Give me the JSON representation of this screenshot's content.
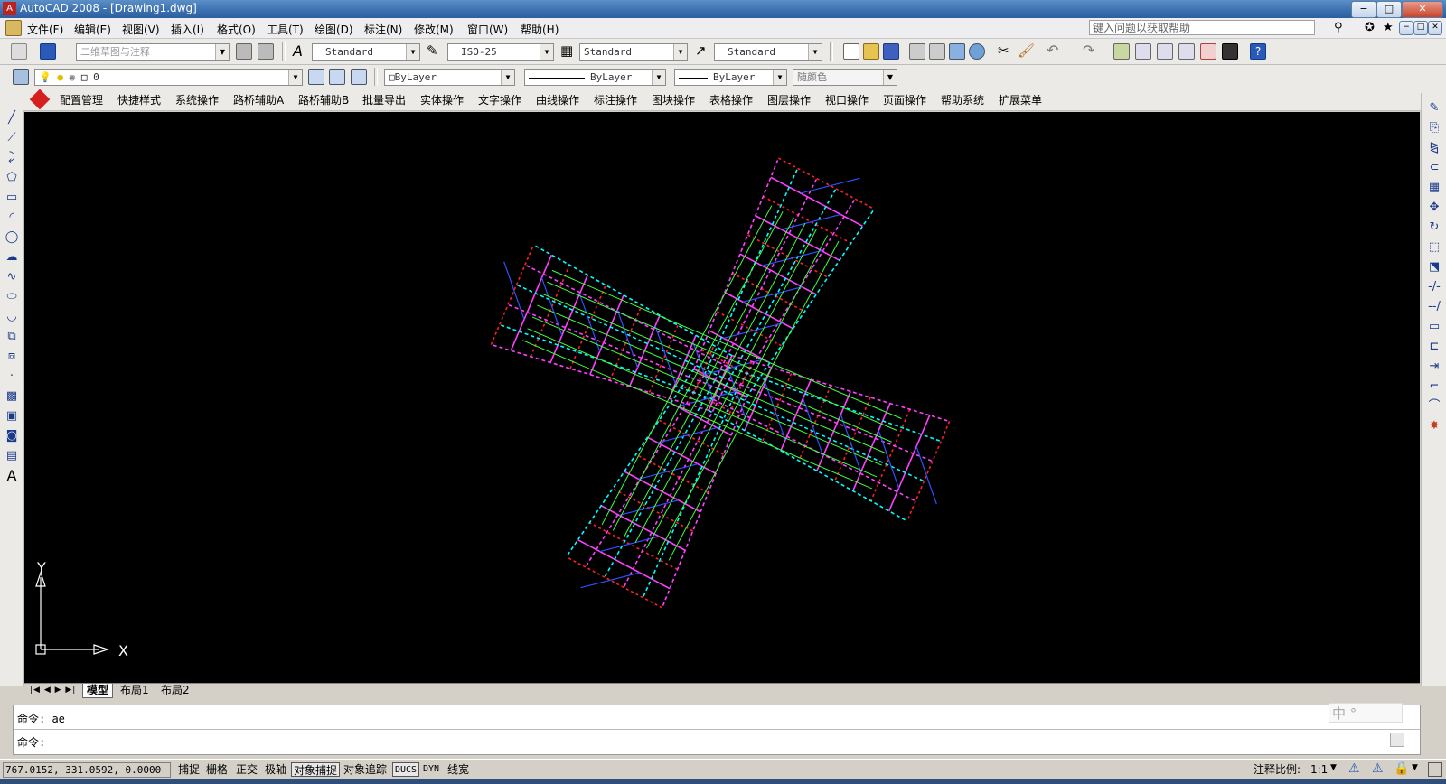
{
  "window": {
    "title": "AutoCAD 2008 - [Drawing1.dwg]",
    "min_label": "−",
    "max_label": "□",
    "close_label": "✕"
  },
  "menubar": {
    "items": [
      "文件(F)",
      "编辑(E)",
      "视图(V)",
      "插入(I)",
      "格式(O)",
      "工具(T)",
      "绘图(D)",
      "标注(N)",
      "修改(M)",
      "窗口(W)",
      "帮助(H)"
    ],
    "help_placeholder": "键入问题以获取帮助"
  },
  "toolbar1": {
    "workspace": "二维草图与注释",
    "text_style": "Standard",
    "dim_style": "ISO-25",
    "table_style": "Standard",
    "multileader_style": "Standard"
  },
  "toolbar2": {
    "layer": "0",
    "color": "ByLayer",
    "linetype": "ByLayer",
    "lineweight": "ByLayer",
    "plotstyle": "随颜色"
  },
  "custom_menu": {
    "items": [
      "配置管理",
      "快捷样式",
      "系统操作",
      "路桥辅助A",
      "路桥辅助B",
      "批量导出",
      "实体操作",
      "文字操作",
      "曲线操作",
      "标注操作",
      "图块操作",
      "表格操作",
      "图层操作",
      "视口操作",
      "页面操作",
      "帮助系统",
      "扩展菜单"
    ]
  },
  "ucs": {
    "x_label": "X",
    "y_label": "Y"
  },
  "tabs": [
    "模型",
    "布局1",
    "布局2"
  ],
  "command": {
    "history": "命令: ae",
    "prompt": "命令:",
    "ime_label": "中 °"
  },
  "status": {
    "coords": "767.0152,  331.0592,  0.0000",
    "toggles": [
      {
        "label": "捕捉",
        "on": false
      },
      {
        "label": "栅格",
        "on": false
      },
      {
        "label": "正交",
        "on": false
      },
      {
        "label": "极轴",
        "on": false
      },
      {
        "label": "对象捕捉",
        "on": true
      },
      {
        "label": "对象追踪",
        "on": false
      },
      {
        "label": "DUCS",
        "on": true
      },
      {
        "label": "DYN",
        "on": false
      },
      {
        "label": "线宽",
        "on": false
      }
    ],
    "anno_scale_label": "注释比例:",
    "anno_scale_value": "1:1"
  },
  "colors": {
    "canvas_bg": "#000000",
    "red": "#ff2020",
    "cyan": "#00ffff",
    "magenta": "#ff40ff",
    "blue": "#3050ff",
    "green": "#40ff40"
  }
}
